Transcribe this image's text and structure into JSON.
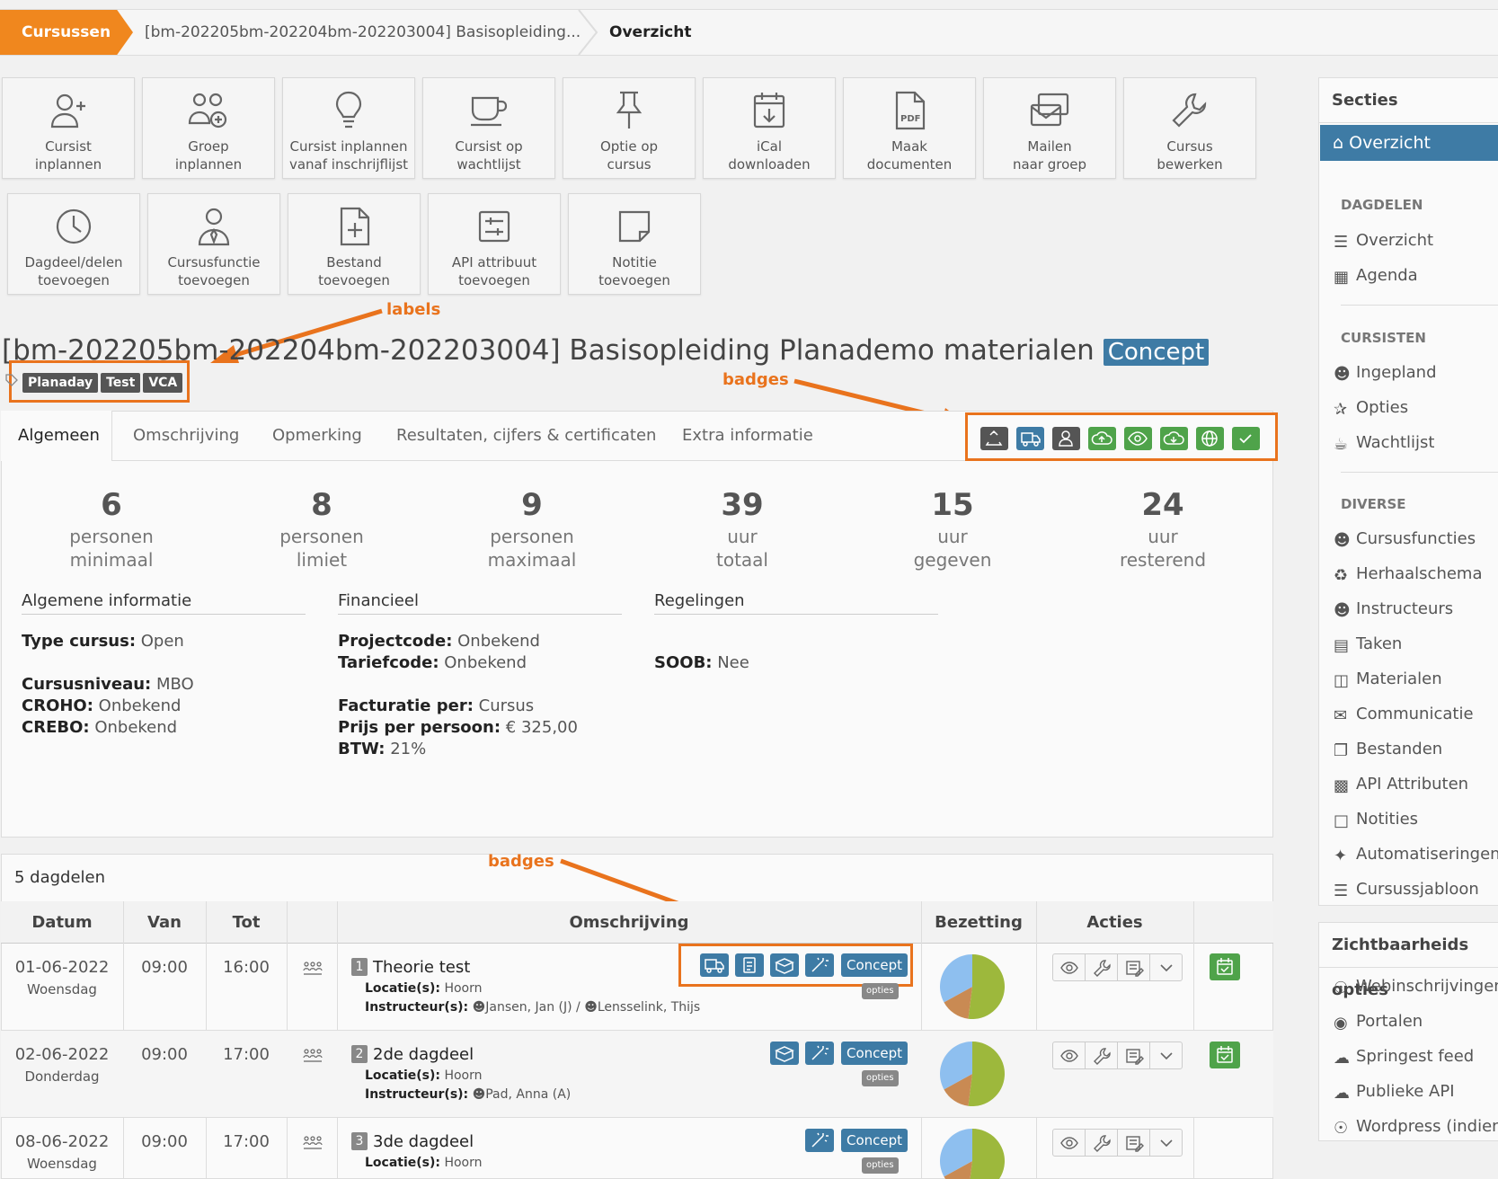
{
  "breadcrumb": {
    "home": "Cursussen",
    "course": "[bm-202205bm-202204bm-202203004] Basisopleiding...",
    "current": "Overzicht"
  },
  "toolbar": {
    "tiles": [
      {
        "icon": "user-plus-icon",
        "line1": "Cursist",
        "line2": "inplannen"
      },
      {
        "icon": "users-plus-icon",
        "line1": "Groep",
        "line2": "inplannen"
      },
      {
        "icon": "lightbulb-icon",
        "line1": "Cursist inplannen",
        "line2": "vanaf inschrijflijst"
      },
      {
        "icon": "cup-icon",
        "line1": "Cursist op",
        "line2": "wachtlijst"
      },
      {
        "icon": "pin-icon",
        "line1": "Optie op",
        "line2": "cursus"
      },
      {
        "icon": "calendar-download-icon",
        "line1": "iCal",
        "line2": "downloaden"
      },
      {
        "icon": "pdf-icon",
        "line1": "Maak",
        "line2": "documenten"
      },
      {
        "icon": "mail-group-icon",
        "line1": "Mailen",
        "line2": "naar groep"
      },
      {
        "icon": "wrench-icon",
        "line1": "Cursus",
        "line2": "bewerken"
      },
      {
        "icon": "clock-icon",
        "line1": "Dagdeel/delen",
        "line2": "toevoegen"
      },
      {
        "icon": "user-tie-icon",
        "line1": "Cursusfunctie",
        "line2": "toevoegen"
      },
      {
        "icon": "file-plus-icon",
        "line1": "Bestand",
        "line2": "toevoegen"
      },
      {
        "icon": "sliders-icon",
        "line1": "API attribuut",
        "line2": "toevoegen"
      },
      {
        "icon": "note-icon",
        "line1": "Notitie",
        "line2": "toevoegen"
      }
    ]
  },
  "course": {
    "title": "[bm-202205bm-202204bm-202203004] Basisopleiding Planademo materialen",
    "status": "Concept",
    "labels": [
      "Planaday",
      "Test",
      "VCA"
    ]
  },
  "annotations": {
    "labels": "labels",
    "badges_top": "badges",
    "badges_table": "badges"
  },
  "tabs": [
    "Algemeen",
    "Omschrijving",
    "Opmerking",
    "Resultaten, cijfers & certificaten",
    "Extra informatie"
  ],
  "badges": [
    {
      "icon": "recycle-icon",
      "color": "#555555"
    },
    {
      "icon": "truck-icon",
      "color": "#3e7ba5"
    },
    {
      "icon": "instructor-icon",
      "color": "#555555"
    },
    {
      "icon": "cloud-upload-icon",
      "color": "#4fa34a"
    },
    {
      "icon": "eye-icon",
      "color": "#4fa34a"
    },
    {
      "icon": "cloud-download-icon",
      "color": "#4fa34a"
    },
    {
      "icon": "globe-icon",
      "color": "#4fa34a"
    },
    {
      "icon": "check-icon",
      "color": "#4fa34a"
    }
  ],
  "stats": [
    {
      "value": "6",
      "line1": "personen",
      "line2": "minimaal"
    },
    {
      "value": "8",
      "line1": "personen",
      "line2": "limiet"
    },
    {
      "value": "9",
      "line1": "personen",
      "line2": "maximaal"
    },
    {
      "value": "39",
      "line1": "uur",
      "line2": "totaal"
    },
    {
      "value": "15",
      "line1": "uur",
      "line2": "gegeven"
    },
    {
      "value": "24",
      "line1": "uur",
      "line2": "resterend"
    }
  ],
  "info": {
    "general": {
      "heading": "Algemene informatie",
      "type_label": "Type cursus:",
      "type_value": " Open",
      "level_label": "Cursusniveau:",
      "level_value": " MBO",
      "croho_label": "CROHO:",
      "croho_value": " Onbekend",
      "crebo_label": "CREBO:",
      "crebo_value": " Onbekend"
    },
    "financial": {
      "heading": "Financieel",
      "project_label": "Projectcode:",
      "project_value": " Onbekend",
      "tariff_label": "Tariefcode:",
      "tariff_value": " Onbekend",
      "invoice_label": "Facturatie per:",
      "invoice_value": " Cursus",
      "price_label": "Prijs per persoon:",
      "price_value": " € 325,00",
      "vat_label": "BTW:",
      "vat_value": " 21%"
    },
    "rules": {
      "heading": "Regelingen",
      "soob_label": "SOOB:",
      "soob_value": " Nee"
    }
  },
  "dayparts": {
    "heading": "5 dagdelen",
    "columns": [
      "Datum",
      "Van",
      "Tot",
      "",
      "Omschrijving",
      "Bezetting",
      "Acties"
    ],
    "locatie_label": "Locatie(s):",
    "instructeur_label": "Instructeur(s):",
    "opties_label": "opties",
    "rows": [
      {
        "date": "01-06-2022",
        "day": "Woensdag",
        "from": "09:00",
        "to": "16:00",
        "nr": "1",
        "title": "Theorie test",
        "location": " Hoorn",
        "instructor1": "Jansen, Jan (J) /",
        "instructor2": "Lensselink, Thijs",
        "status": "Concept",
        "occupancy": 0.72
      },
      {
        "date": "02-06-2022",
        "day": "Donderdag",
        "from": "09:00",
        "to": "17:00",
        "nr": "2",
        "title": "2de dagdeel",
        "location": " Hoorn",
        "instructor1": "Pad, Anna (A)",
        "status": "Concept",
        "occupancy": 0.72
      },
      {
        "date": "08-06-2022",
        "day": "Woensdag",
        "from": "09:00",
        "to": "17:00",
        "nr": "3",
        "title": "3de dagdeel",
        "location": " Hoorn",
        "status": "Concept",
        "occupancy": 0.72
      }
    ]
  },
  "sidebar": {
    "heading": "Secties",
    "active": "Overzicht",
    "cat_dagdelen": "DAGDELEN",
    "dagdelen": [
      "Overzicht",
      "Agenda"
    ],
    "cat_cursisten": "CURSISTEN",
    "cursisten": [
      "Ingepland",
      "Opties",
      "Wachtlijst"
    ],
    "cat_diverse": "DIVERSE",
    "diverse": [
      "Cursusfuncties",
      "Herhaalschema",
      "Instructeurs",
      "Taken",
      "Materialen",
      "Communicatie",
      "Bestanden",
      "API Attributen",
      "Notities",
      "Automatiseringen",
      "Cursussjabloon"
    ],
    "visibility_heading": "Zichtbaarheids opties",
    "visibility": [
      "Webinschrijvingen",
      "Portalen",
      "Springest feed",
      "Publieke API",
      "Wordpress (indien"
    ]
  },
  "colors": {
    "accent": "#f0871e",
    "primary": "#3e7ba5",
    "success": "#4fa34a",
    "annotation": "#e9731d"
  }
}
